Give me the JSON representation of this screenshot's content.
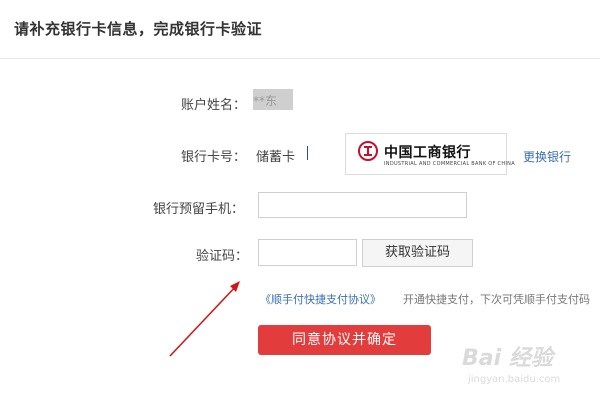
{
  "header": {
    "title": "请补充银行卡信息，完成银行卡验证"
  },
  "form": {
    "name_label": "账户姓名：",
    "name_value": "**东",
    "card_label": "银行卡号：",
    "card_type": "储蓄卡",
    "bank": {
      "name": "中国工商银行",
      "subtitle": "INDUSTRIAL AND COMMERCIAL BANK OF CHINA"
    },
    "change_bank_link": "更换银行",
    "phone_label": "银行预留手机：",
    "phone_value": "",
    "code_label": "验证码：",
    "code_value": "",
    "get_code_button": "获取验证码",
    "agreement_link": "《顺手付快捷支付协议》",
    "agreement_note": "开通快捷支付，下次可凭顺手付支付码",
    "submit_button": "同意协议并确定"
  },
  "watermark": {
    "brand": "Bai 经验",
    "url": "jingyan.baidu.com"
  },
  "colors": {
    "accent_red": "#e33c3c",
    "link_blue": "#3a6fb5",
    "icbc_red": "#c8102e",
    "arrow_red": "#d01818"
  }
}
